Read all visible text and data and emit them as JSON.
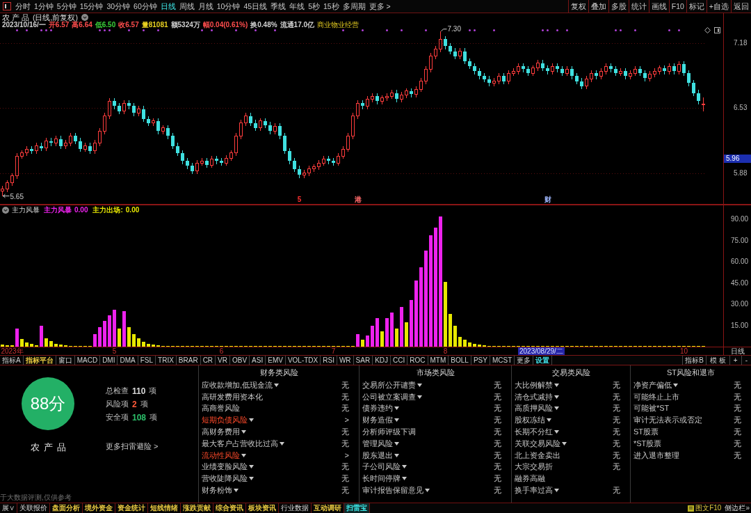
{
  "toolbar": {
    "periods": [
      {
        "label": "分时",
        "selected": false
      },
      {
        "label": "1分钟",
        "selected": false
      },
      {
        "label": "5分钟",
        "selected": false
      },
      {
        "label": "15分钟",
        "selected": false
      },
      {
        "label": "30分钟",
        "selected": false
      },
      {
        "label": "60分钟",
        "selected": false
      },
      {
        "label": "日线",
        "selected": true
      },
      {
        "label": "周线",
        "selected": false
      },
      {
        "label": "月线",
        "selected": false
      },
      {
        "label": "10分钟",
        "selected": false
      },
      {
        "label": "45日线",
        "selected": false
      },
      {
        "label": "季线",
        "selected": false
      },
      {
        "label": "年线",
        "selected": false
      },
      {
        "label": "5秒",
        "selected": false
      },
      {
        "label": "15秒",
        "selected": false
      },
      {
        "label": "多周期",
        "selected": false
      }
    ],
    "more": "更多 >",
    "actions": [
      "复权",
      "叠加",
      "多股",
      "统计",
      "画线",
      "F10",
      "标记",
      "+自选",
      "返回"
    ]
  },
  "chart_header": {
    "name": "农产品",
    "mode": "(日线,前复权)",
    "quote": [
      {
        "text": "2023/10/16/一",
        "color": "#d0d0d0"
      },
      {
        "text": "开6.57",
        "color": "#ff4d4d"
      },
      {
        "text": "高6.64",
        "color": "#ff4d4d"
      },
      {
        "text": "低6.50",
        "color": "#3ad13a"
      },
      {
        "text": "收6.57",
        "color": "#ff4d4d"
      },
      {
        "text": "量81081",
        "color": "#e8d020"
      },
      {
        "text": "额5324万",
        "color": "#d0d0d0"
      },
      {
        "text": "幅0.04(0.61%)",
        "color": "#ff4d4d"
      },
      {
        "text": "换0.48%",
        "color": "#d0d0d0"
      },
      {
        "text": "流通17.0亿",
        "color": "#d0d0d0"
      }
    ],
    "sector": "商业物业经营"
  },
  "chart_data": [
    {
      "type": "candlestick",
      "ylim": [
        5.57,
        7.48
      ],
      "yticks": [
        5.88,
        6.53,
        7.18
      ],
      "grid": true,
      "categories": [
        null,
        null,
        null,
        null,
        null,
        null,
        null,
        null,
        null,
        null,
        null,
        null,
        null,
        null,
        null,
        null,
        null,
        null,
        null,
        null,
        null,
        null,
        null,
        null,
        null,
        null,
        null,
        null,
        null,
        null,
        null,
        null,
        null,
        null,
        null,
        null,
        null,
        null,
        null,
        null,
        null,
        null,
        null,
        null,
        null,
        null,
        null,
        null,
        null,
        null,
        null,
        null,
        null,
        null,
        null,
        null,
        null,
        null,
        null,
        null,
        null,
        "5",
        null,
        null,
        null,
        null,
        null,
        null,
        null,
        null,
        null,
        null,
        null,
        "港",
        null,
        null,
        null,
        null,
        null,
        null,
        null,
        null,
        null,
        null,
        null,
        null,
        null,
        null,
        null,
        null,
        null,
        null,
        null,
        null,
        null,
        null,
        null,
        null,
        null,
        null,
        null,
        null,
        null,
        null,
        null,
        null,
        null,
        null,
        null,
        null,
        null,
        null,
        "财",
        null,
        null,
        null,
        null,
        null,
        null,
        null,
        null,
        null,
        null,
        null,
        null,
        null,
        null,
        null,
        null,
        null,
        null,
        null,
        null,
        null,
        null,
        null,
        null,
        null,
        null,
        null,
        null,
        null,
        null,
        null,
        null
      ],
      "ohlc": [
        [
          5.7,
          5.75,
          5.65,
          5.72
        ],
        [
          5.72,
          5.81,
          5.69,
          5.78
        ],
        [
          5.78,
          5.88,
          5.75,
          5.85
        ],
        [
          5.85,
          6.08,
          5.82,
          6.05
        ],
        [
          6.05,
          6.11,
          6.02,
          6.08
        ],
        [
          6.08,
          6.15,
          6.05,
          6.12
        ],
        [
          6.12,
          6.15,
          6.07,
          6.1
        ],
        [
          6.1,
          6.18,
          6.07,
          6.15
        ],
        [
          6.15,
          6.18,
          6.1,
          6.13
        ],
        [
          6.13,
          6.23,
          6.1,
          6.2
        ],
        [
          6.2,
          6.23,
          6.15,
          6.18
        ],
        [
          6.18,
          6.25,
          6.15,
          6.22
        ],
        [
          6.22,
          6.25,
          6.12,
          6.15
        ],
        [
          6.15,
          6.21,
          6.12,
          6.18
        ],
        [
          6.18,
          6.28,
          6.15,
          6.25
        ],
        [
          6.25,
          6.28,
          6.17,
          6.2
        ],
        [
          6.2,
          6.23,
          6.09,
          6.12
        ],
        [
          6.12,
          6.18,
          6.09,
          6.15
        ],
        [
          6.15,
          6.18,
          6.07,
          6.1
        ],
        [
          6.1,
          6.21,
          6.07,
          6.18
        ],
        [
          6.18,
          6.33,
          6.15,
          6.3
        ],
        [
          6.3,
          6.48,
          6.27,
          6.45
        ],
        [
          6.45,
          6.63,
          6.42,
          6.6
        ],
        [
          6.6,
          6.63,
          6.52,
          6.55
        ],
        [
          6.55,
          6.58,
          6.47,
          6.5
        ],
        [
          6.5,
          6.61,
          6.47,
          6.58
        ],
        [
          6.58,
          6.61,
          6.52,
          6.55
        ],
        [
          6.55,
          6.58,
          6.45,
          6.48
        ],
        [
          6.48,
          6.55,
          6.45,
          6.52
        ],
        [
          6.52,
          6.55,
          6.39,
          6.42
        ],
        [
          6.42,
          6.45,
          6.35,
          6.38
        ],
        [
          6.38,
          6.43,
          6.35,
          6.4
        ],
        [
          6.4,
          6.43,
          6.27,
          6.3
        ],
        [
          6.3,
          6.36,
          6.27,
          6.33
        ],
        [
          6.33,
          6.36,
          6.22,
          6.25
        ],
        [
          6.25,
          6.28,
          6.12,
          6.15
        ],
        [
          6.15,
          6.18,
          6.05,
          6.08
        ],
        [
          6.08,
          6.11,
          5.97,
          6.0
        ],
        [
          6.0,
          6.03,
          5.92,
          5.95
        ],
        [
          5.95,
          5.98,
          5.87,
          5.9
        ],
        [
          5.9,
          6.01,
          5.87,
          5.98
        ],
        [
          5.98,
          6.03,
          5.95,
          6.0
        ],
        [
          6.0,
          6.03,
          5.93,
          5.96
        ],
        [
          5.96,
          6.05,
          5.93,
          6.02
        ],
        [
          6.02,
          6.05,
          5.97,
          6.0
        ],
        [
          6.0,
          6.03,
          5.95,
          5.98
        ],
        [
          5.98,
          6.06,
          5.95,
          6.03
        ],
        [
          6.03,
          6.11,
          6.0,
          6.08
        ],
        [
          6.08,
          6.28,
          6.05,
          6.25
        ],
        [
          6.25,
          6.41,
          6.22,
          6.38
        ],
        [
          6.38,
          6.48,
          6.35,
          6.45
        ],
        [
          6.45,
          6.48,
          6.35,
          6.38
        ],
        [
          6.38,
          6.41,
          6.3,
          6.33
        ],
        [
          6.33,
          6.43,
          6.3,
          6.4
        ],
        [
          6.4,
          6.43,
          6.33,
          6.36
        ],
        [
          6.36,
          6.39,
          6.27,
          6.3
        ],
        [
          6.3,
          6.38,
          6.27,
          6.35
        ],
        [
          6.35,
          6.38,
          6.22,
          6.25
        ],
        [
          6.25,
          6.28,
          6.07,
          6.1
        ],
        [
          6.1,
          6.13,
          5.97,
          6.0
        ],
        [
          6.0,
          6.03,
          5.89,
          5.92
        ],
        [
          5.92,
          5.95,
          5.83,
          5.86
        ],
        [
          5.86,
          5.91,
          5.83,
          5.88
        ],
        [
          5.88,
          5.95,
          5.85,
          5.92
        ],
        [
          5.92,
          5.97,
          5.89,
          5.94
        ],
        [
          5.94,
          6.01,
          5.91,
          5.98
        ],
        [
          5.98,
          6.05,
          5.95,
          6.02
        ],
        [
          6.02,
          6.05,
          5.97,
          6.0
        ],
        [
          6.0,
          6.03,
          5.95,
          5.98
        ],
        [
          5.98,
          6.08,
          5.95,
          6.05
        ],
        [
          6.05,
          6.15,
          6.02,
          6.12
        ],
        [
          6.12,
          6.28,
          6.09,
          6.25
        ],
        [
          6.25,
          6.48,
          6.22,
          6.45
        ],
        [
          6.45,
          6.61,
          6.42,
          6.58
        ],
        [
          6.58,
          6.61,
          6.52,
          6.55
        ],
        [
          6.55,
          6.65,
          6.52,
          6.62
        ],
        [
          6.62,
          6.68,
          6.59,
          6.65
        ],
        [
          6.65,
          6.68,
          6.57,
          6.6
        ],
        [
          6.6,
          6.66,
          6.57,
          6.63
        ],
        [
          6.63,
          6.68,
          6.6,
          6.65
        ],
        [
          6.65,
          6.71,
          6.62,
          6.68
        ],
        [
          6.68,
          6.71,
          6.59,
          6.62
        ],
        [
          6.62,
          6.69,
          6.59,
          6.66
        ],
        [
          6.66,
          6.73,
          6.63,
          6.7
        ],
        [
          6.7,
          6.73,
          6.64,
          6.67
        ],
        [
          6.67,
          6.75,
          6.64,
          6.72
        ],
        [
          6.72,
          6.83,
          6.69,
          6.8
        ],
        [
          6.8,
          6.95,
          6.77,
          6.92
        ],
        [
          6.92,
          7.08,
          6.89,
          7.05
        ],
        [
          7.05,
          7.15,
          7.02,
          7.12
        ],
        [
          7.12,
          7.3,
          7.09,
          7.22
        ],
        [
          7.22,
          7.25,
          7.12,
          7.15
        ],
        [
          7.15,
          7.18,
          7.07,
          7.1
        ],
        [
          7.1,
          7.13,
          7.02,
          7.05
        ],
        [
          7.05,
          7.13,
          7.02,
          7.1
        ],
        [
          7.1,
          7.13,
          6.97,
          7.0
        ],
        [
          7.0,
          7.03,
          6.92,
          6.95
        ],
        [
          6.95,
          6.98,
          6.87,
          6.9
        ],
        [
          6.9,
          6.93,
          6.82,
          6.85
        ],
        [
          6.85,
          6.88,
          6.79,
          6.82
        ],
        [
          6.82,
          6.85,
          6.75,
          6.78
        ],
        [
          6.78,
          6.83,
          6.75,
          6.8
        ],
        [
          6.8,
          6.88,
          6.77,
          6.85
        ],
        [
          6.85,
          6.88,
          6.77,
          6.8
        ],
        [
          6.8,
          6.91,
          6.77,
          6.88
        ],
        [
          6.88,
          6.93,
          6.85,
          6.9
        ],
        [
          6.9,
          6.98,
          6.87,
          6.95
        ],
        [
          6.95,
          6.98,
          6.89,
          6.92
        ],
        [
          6.92,
          6.95,
          6.85,
          6.88
        ],
        [
          6.88,
          6.96,
          6.85,
          6.93
        ],
        [
          6.93,
          7.01,
          6.9,
          6.98
        ],
        [
          6.98,
          7.01,
          6.9,
          6.93
        ],
        [
          6.93,
          6.96,
          6.87,
          6.9
        ],
        [
          6.9,
          6.98,
          6.87,
          6.95
        ],
        [
          6.95,
          6.98,
          6.89,
          6.92
        ],
        [
          6.92,
          6.95,
          6.85,
          6.88
        ],
        [
          6.88,
          6.95,
          6.85,
          6.92
        ],
        [
          6.92,
          6.95,
          6.82,
          6.85
        ],
        [
          6.85,
          6.88,
          6.77,
          6.8
        ],
        [
          6.8,
          6.83,
          6.72,
          6.75
        ],
        [
          6.75,
          6.85,
          6.72,
          6.82
        ],
        [
          6.82,
          6.91,
          6.79,
          6.88
        ],
        [
          6.88,
          6.91,
          6.82,
          6.85
        ],
        [
          6.85,
          6.93,
          6.82,
          6.9
        ],
        [
          6.9,
          6.98,
          6.87,
          6.95
        ],
        [
          6.95,
          6.98,
          6.89,
          6.92
        ],
        [
          6.92,
          6.95,
          6.85,
          6.88
        ],
        [
          6.88,
          6.93,
          6.85,
          6.9
        ],
        [
          6.9,
          6.93,
          6.82,
          6.85
        ],
        [
          6.85,
          6.91,
          6.82,
          6.88
        ],
        [
          6.88,
          6.95,
          6.85,
          6.92
        ],
        [
          6.92,
          6.95,
          6.85,
          6.88
        ],
        [
          6.88,
          6.91,
          6.8,
          6.83
        ],
        [
          6.83,
          6.9,
          6.8,
          6.87
        ],
        [
          6.87,
          6.93,
          6.84,
          6.9
        ],
        [
          6.9,
          6.96,
          6.87,
          6.93
        ],
        [
          6.93,
          6.96,
          6.87,
          6.9
        ],
        [
          6.9,
          6.98,
          6.87,
          6.95
        ],
        [
          6.95,
          6.98,
          6.87,
          6.9
        ],
        [
          6.9,
          7.0,
          6.87,
          6.97
        ],
        [
          6.97,
          7.0,
          6.85,
          6.88
        ],
        [
          6.88,
          6.91,
          6.75,
          6.78
        ],
        [
          6.78,
          6.81,
          6.65,
          6.68
        ],
        [
          6.68,
          6.71,
          6.57,
          6.6
        ],
        [
          6.57,
          6.64,
          6.5,
          6.57
        ]
      ],
      "annotations": [
        "7.30",
        "5.65"
      ]
    },
    {
      "type": "bar",
      "ylim": [
        0,
        100
      ],
      "yticks": [
        {
          "value": 15,
          "label": "15.00"
        },
        {
          "value": 30,
          "label": "30.00"
        },
        {
          "value": 45,
          "label": "45.00"
        },
        {
          "value": 60,
          "label": "60.00"
        },
        {
          "value": 75,
          "label": "75.00"
        },
        {
          "value": 90,
          "label": "90.00"
        }
      ],
      "categories": [
        null,
        null,
        "2023年",
        null,
        null,
        null,
        null,
        null,
        null,
        null,
        null,
        null,
        null,
        null,
        null,
        null,
        null,
        null,
        null,
        null,
        null,
        null,
        null,
        "5",
        null,
        null,
        null,
        null,
        null,
        null,
        null,
        null,
        null,
        null,
        null,
        null,
        null,
        null,
        null,
        null,
        null,
        null,
        null,
        null,
        null,
        "6",
        null,
        null,
        null,
        null,
        null,
        null,
        null,
        null,
        null,
        null,
        null,
        null,
        null,
        null,
        null,
        null,
        null,
        null,
        null,
        null,
        null,
        null,
        "7",
        null,
        null,
        null,
        null,
        null,
        null,
        null,
        null,
        null,
        null,
        null,
        null,
        null,
        null,
        null,
        null,
        null,
        null,
        null,
        null,
        null,
        null,
        "8",
        null,
        null,
        null,
        null,
        null,
        null,
        null,
        null,
        null,
        null,
        null,
        null,
        null,
        null,
        null,
        null,
        null,
        null,
        null,
        null,
        null,
        null,
        null,
        null,
        null,
        null,
        null,
        null,
        null,
        null,
        null,
        null,
        null,
        null,
        null,
        null,
        null,
        null,
        null,
        null,
        null,
        null,
        null,
        null,
        null,
        null,
        null,
        null,
        "10",
        null,
        null,
        null,
        null
      ],
      "series": [
        {
          "color": "#ee22ee",
          "values": [
            null,
            null,
            null,
            13,
            null,
            null,
            null,
            null,
            15,
            null,
            null,
            null,
            null,
            null,
            null,
            null,
            null,
            null,
            null,
            9,
            14,
            18,
            22,
            26,
            null,
            25,
            null,
            null,
            null,
            null,
            null,
            null,
            null,
            null,
            null,
            null,
            null,
            null,
            null,
            null,
            null,
            null,
            null,
            null,
            null,
            null,
            null,
            null,
            null,
            null,
            null,
            null,
            null,
            null,
            null,
            null,
            null,
            null,
            null,
            null,
            null,
            null,
            null,
            null,
            null,
            null,
            null,
            null,
            null,
            null,
            null,
            null,
            null,
            9,
            null,
            8,
            15,
            20,
            null,
            20,
            24,
            null,
            28,
            null,
            33,
            47,
            56,
            68,
            79,
            84,
            92,
            null,
            null,
            null,
            null,
            null,
            null,
            null,
            null,
            null,
            null,
            null,
            null,
            null,
            null,
            null,
            null,
            null,
            null,
            null,
            null,
            null,
            null,
            null,
            null,
            null,
            null,
            null,
            null,
            null,
            null,
            null,
            null,
            null,
            null,
            null,
            null,
            null,
            null,
            null,
            null,
            null,
            null,
            null,
            null,
            null,
            null,
            null,
            null,
            null,
            null,
            null,
            null,
            null,
            null
          ]
        },
        {
          "color": "#e8e800",
          "values": [
            1.5,
            1,
            1,
            null,
            5.5,
            3,
            2,
            1,
            null,
            6,
            4,
            2,
            1.5,
            1,
            0.5,
            0.5,
            0.5,
            0.5,
            0.5,
            null,
            null,
            null,
            null,
            null,
            13,
            null,
            14,
            9,
            6,
            3.5,
            2,
            1.5,
            1,
            0,
            0,
            0,
            0,
            0,
            0,
            0,
            0,
            0,
            0,
            0,
            0,
            0,
            0,
            0,
            0,
            0,
            0,
            0,
            0,
            0,
            0,
            0,
            0,
            0,
            0,
            0,
            0,
            0,
            0,
            0,
            0,
            0,
            0,
            0,
            0,
            0,
            0,
            0,
            0,
            null,
            5,
            null,
            null,
            null,
            11,
            null,
            null,
            13,
            null,
            17,
            null,
            null,
            null,
            null,
            null,
            null,
            null,
            46,
            23,
            15,
            7,
            5,
            3,
            2,
            1.5,
            1,
            0,
            0,
            0,
            0,
            0,
            0,
            0,
            0,
            0,
            0,
            0,
            0,
            0,
            0,
            0,
            0,
            0,
            0,
            0,
            0,
            0,
            0,
            0,
            0,
            0,
            0,
            0,
            0,
            0,
            0,
            0,
            0,
            0,
            0,
            0,
            0,
            0,
            0,
            0,
            0,
            0,
            0,
            0,
            0,
            0
          ]
        }
      ]
    }
  ],
  "signal_dots": [
    false,
    false,
    false,
    true,
    false,
    true,
    false,
    false,
    true,
    true,
    true,
    false,
    false,
    false,
    false,
    false,
    false,
    false,
    false,
    false,
    true,
    true,
    true,
    false,
    false,
    false,
    true,
    false,
    false,
    true,
    false,
    false,
    true,
    false,
    false,
    false,
    false,
    false,
    false,
    false,
    false,
    true,
    false,
    true,
    false,
    false,
    false,
    false,
    true,
    false,
    false,
    false,
    true,
    false,
    false,
    false,
    true,
    false,
    false,
    false,
    false,
    false,
    false,
    false,
    false,
    false,
    false,
    false,
    false,
    false,
    true,
    false,
    false,
    false,
    true,
    false,
    false,
    false,
    false,
    true,
    false,
    false,
    true,
    false,
    false,
    false,
    false,
    true,
    false,
    false,
    false,
    false,
    false,
    false,
    false,
    false,
    true,
    true,
    false,
    false,
    false,
    true,
    false,
    false,
    false,
    false,
    false,
    false,
    false,
    false,
    false,
    true,
    true,
    false,
    true,
    false,
    true,
    false,
    false,
    false,
    false,
    false,
    false,
    false,
    false,
    false,
    true,
    true,
    false,
    false,
    true,
    false,
    false,
    false,
    false,
    false,
    false,
    true,
    false,
    true,
    false,
    false,
    false,
    false,
    false
  ],
  "event_flags": [
    {
      "color": "#ff3030"
    },
    {
      "color": "#ff6a6a"
    },
    {
      "color": "#a0b8ff"
    }
  ],
  "crosshair": {
    "price": "5.96",
    "date": "2023/08/29/二"
  },
  "indicator_legend": {
    "title": "主力风暴",
    "readouts": [
      {
        "label": "主力风暴",
        "value": "0.00",
        "color": "#ee22ee"
      },
      {
        "label": "主力出场:",
        "value": "0.00",
        "color": "#e8e800"
      }
    ]
  },
  "x_axis": {
    "period": "日线"
  },
  "indicator_tabs": {
    "group_a": "指标A",
    "items": [
      {
        "label": "指标平台",
        "color": "#e8c840"
      },
      {
        "label": "窗口"
      },
      {
        "label": "MACD"
      },
      {
        "label": "DMI"
      },
      {
        "label": "DMA"
      },
      {
        "label": "FSL"
      },
      {
        "label": "TRIX"
      },
      {
        "label": "BRAR"
      },
      {
        "label": "CR"
      },
      {
        "label": "VR"
      },
      {
        "label": "OBV"
      },
      {
        "label": "ASI"
      },
      {
        "label": "EMV"
      },
      {
        "label": "VOL-TDX"
      },
      {
        "label": "RSI"
      },
      {
        "label": "WR"
      },
      {
        "label": "SAR"
      },
      {
        "label": "KDJ"
      },
      {
        "label": "CCI"
      },
      {
        "label": "ROC"
      },
      {
        "label": "MTM"
      },
      {
        "label": "BOLL"
      },
      {
        "label": "PSY"
      },
      {
        "label": "MCST"
      },
      {
        "label": "更多"
      },
      {
        "label": "设置",
        "color": "#40d8e0"
      }
    ],
    "group_b": "指标B",
    "tools": [
      "模 板",
      "+",
      "-"
    ]
  },
  "risk_scan": {
    "score": "88分",
    "name": "农产品",
    "stats": [
      {
        "label": "总检查",
        "value": "110",
        "unit": "项",
        "color": "#d8d8d8"
      },
      {
        "label": "风险项",
        "value": "2",
        "unit": "项",
        "color": "#ff5a3a"
      },
      {
        "label": "安全项",
        "value": "108",
        "unit": "项",
        "color": "#2cc06a"
      }
    ],
    "more_link": "更多扫雷避险 >",
    "disclaimer": "于大数据评测,仅供参考",
    "columns": [
      {
        "title": "财务类风险",
        "items": [
          {
            "label": "应收款增加,低现金流",
            "expandable": true,
            "risk": false,
            "result": "无"
          },
          {
            "label": "高研发费用资本化",
            "expandable": false,
            "risk": false,
            "result": "无"
          },
          {
            "label": "高商誉风险",
            "expandable": false,
            "risk": false,
            "result": "无"
          },
          {
            "label": "短期负债风险",
            "expandable": true,
            "risk": true,
            "result": ">"
          },
          {
            "label": "高财务费用",
            "expandable": true,
            "risk": false,
            "result": "无"
          },
          {
            "label": "最大客户占营收比过高",
            "expandable": true,
            "risk": false,
            "result": "无"
          },
          {
            "label": "流动性风险",
            "expandable": true,
            "risk": true,
            "result": ">"
          },
          {
            "label": "业绩变脸风险",
            "expandable": true,
            "risk": false,
            "result": "无"
          },
          {
            "label": "营收陡降风险",
            "expandable": true,
            "risk": false,
            "result": "无"
          },
          {
            "label": "财务粉饰",
            "expandable": true,
            "risk": false,
            "result": "无"
          }
        ]
      },
      {
        "title": "市场类风险",
        "items": [
          {
            "label": "交易所公开谴责",
            "expandable": true,
            "risk": false,
            "result": "无"
          },
          {
            "label": "公司被立案调查",
            "expandable": true,
            "risk": false,
            "result": "无"
          },
          {
            "label": "债券违约",
            "expandable": true,
            "risk": false,
            "result": "无"
          },
          {
            "label": "财务造假",
            "expandable": true,
            "risk": false,
            "result": "无"
          },
          {
            "label": "分析师评级下调",
            "expandable": false,
            "risk": false,
            "result": "无"
          },
          {
            "label": "管理风险",
            "expandable": true,
            "risk": false,
            "result": "无"
          },
          {
            "label": "股东退出",
            "expandable": true,
            "risk": false,
            "result": "无"
          },
          {
            "label": "子公司风险",
            "expandable": true,
            "risk": false,
            "result": "无"
          },
          {
            "label": "长时间停牌",
            "expandable": true,
            "risk": false,
            "result": "无"
          },
          {
            "label": "审计报告保留意见",
            "expandable": true,
            "risk": false,
            "result": "无"
          }
        ]
      },
      {
        "title": "交易类风险",
        "items": [
          {
            "label": "大比例解禁",
            "expandable": true,
            "risk": false,
            "result": "无"
          },
          {
            "label": "清仓式减持",
            "expandable": true,
            "risk": false,
            "result": "无"
          },
          {
            "label": "高质押风险",
            "expandable": true,
            "risk": false,
            "result": "无"
          },
          {
            "label": "股权冻结",
            "expandable": true,
            "risk": false,
            "result": "无"
          },
          {
            "label": "长期不分红",
            "expandable": true,
            "risk": false,
            "result": "无"
          },
          {
            "label": "关联交易风险",
            "expandable": true,
            "risk": false,
            "result": "无"
          },
          {
            "label": "北上资金卖出",
            "expandable": false,
            "risk": false,
            "result": "无"
          },
          {
            "label": "大宗交易折",
            "expandable": false,
            "risk": false,
            "result": "无"
          },
          {
            "label": "融券高融",
            "expandable": false,
            "risk": false
          },
          {
            "label": "换手率过高",
            "expandable": true,
            "risk": false,
            "result": "无"
          }
        ]
      },
      {
        "title": "ST风险和退市",
        "items": [
          {
            "label": "净资产偏低",
            "expandable": true,
            "risk": false,
            "result": "无"
          },
          {
            "label": "可能终止上市",
            "expandable": false,
            "risk": false,
            "result": "无"
          },
          {
            "label": "可能被*ST",
            "expandable": false,
            "risk": false,
            "result": "无"
          },
          {
            "label": "审计无法表示或否定",
            "expandable": false,
            "risk": false,
            "result": "无"
          },
          {
            "label": "ST股票",
            "expandable": false,
            "risk": false,
            "result": "无"
          },
          {
            "label": "*ST股票",
            "expandable": false,
            "risk": false,
            "result": "无"
          },
          {
            "label": "进入退市整理",
            "expandable": false,
            "risk": false,
            "result": "无"
          }
        ]
      }
    ]
  },
  "bottom_nav": {
    "items": [
      {
        "label": "展∨",
        "selected": false
      },
      {
        "label": "关联报价",
        "selected": false
      },
      {
        "label": "盘面分析",
        "selected": false,
        "color": "#e8c840"
      },
      {
        "label": "境外资金",
        "selected": false,
        "color": "#e8c840"
      },
      {
        "label": "资金统计",
        "selected": false,
        "color": "#e8c840"
      },
      {
        "label": "短线情绪",
        "selected": false,
        "color": "#e8c840"
      },
      {
        "label": "涨跌贡献",
        "selected": false,
        "color": "#e8c840"
      },
      {
        "label": "综合资讯",
        "selected": false,
        "color": "#e8c840"
      },
      {
        "label": "板块资讯",
        "selected": false,
        "color": "#e8c840"
      },
      {
        "label": "行业数据",
        "selected": false
      },
      {
        "label": "互动调研",
        "selected": false,
        "color": "#e8c840"
      },
      {
        "label": "扫雷宝",
        "selected": true
      }
    ],
    "f10": "图文F10",
    "sidebar": "侧边栏»"
  }
}
